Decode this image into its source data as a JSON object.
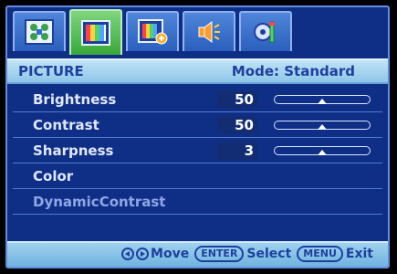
{
  "tabs": [
    {
      "icon": "grid-settings-icon",
      "active": false
    },
    {
      "icon": "picture-colorbars-icon",
      "active": true
    },
    {
      "icon": "picture-advanced-icon",
      "active": false
    },
    {
      "icon": "speaker-icon",
      "active": false
    },
    {
      "icon": "system-settings-icon",
      "active": false
    }
  ],
  "header": {
    "title": "PICTURE",
    "mode": "Mode: Standard"
  },
  "settings": [
    {
      "label": "Brightness",
      "value": "50",
      "level": 0.5
    },
    {
      "label": "Contrast",
      "value": "50",
      "level": 0.5
    },
    {
      "label": "Sharpness",
      "value": "3",
      "level": 0.5
    },
    {
      "label": "Color"
    },
    {
      "label": "DynamicContrast",
      "disabled": true
    }
  ],
  "footer": {
    "move_label": "Move",
    "enter_key": "ENTER",
    "select_label": "Select",
    "menu_key": "MENU",
    "exit_label": "Exit"
  },
  "colors": {
    "panel": "#0f2f86",
    "header": "#a6d4f0",
    "active_tab": "#4fbf4f",
    "text": "#1f3f9f"
  }
}
